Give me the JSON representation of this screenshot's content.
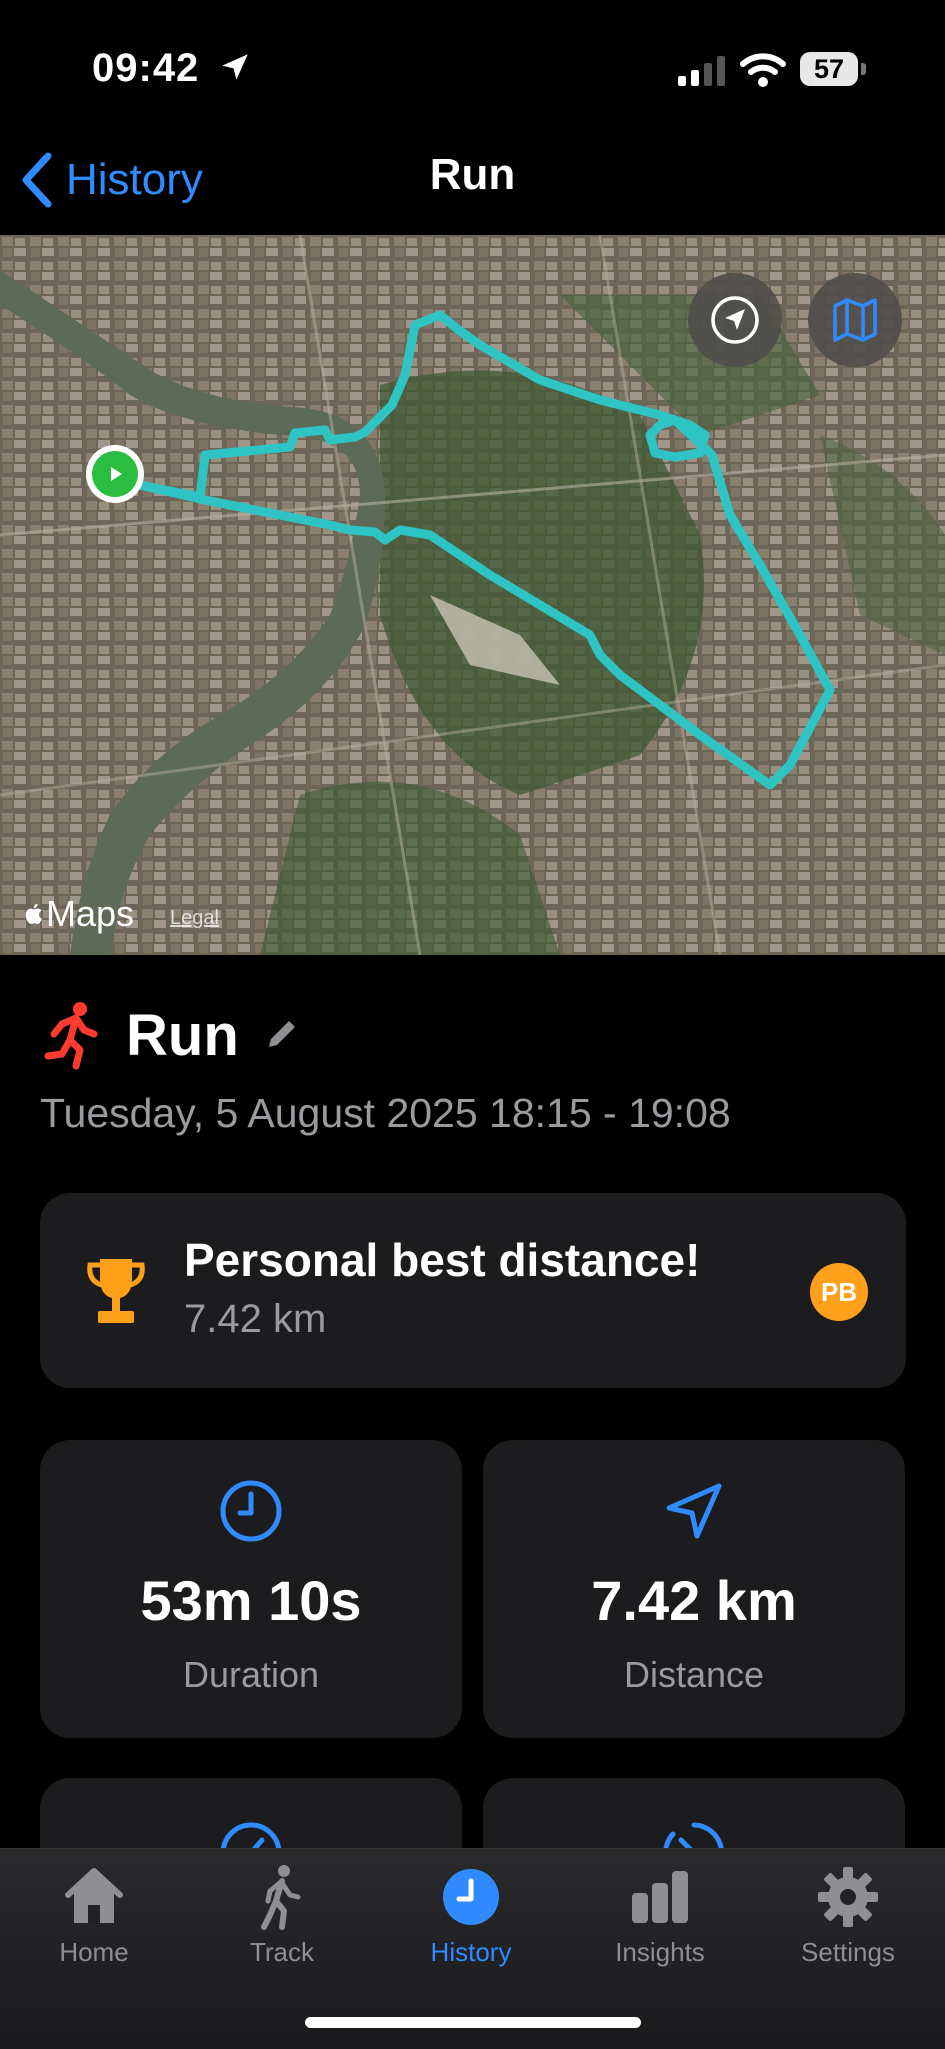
{
  "status_bar": {
    "time": "09:42",
    "battery": "57"
  },
  "nav": {
    "back_label": "History",
    "title": "Run"
  },
  "map": {
    "attribution": "Maps",
    "legal": "Legal",
    "route_color": "#2ec4c4"
  },
  "activity": {
    "title": "Run",
    "datetime": "Tuesday, 5 August 2025 18:15 - 19:08"
  },
  "personal_best": {
    "title": "Personal best distance!",
    "value": "7.42 km",
    "badge": "PB"
  },
  "stats": [
    {
      "value": "53m 10s",
      "label": "Duration",
      "icon": "clock-icon"
    },
    {
      "value": "7.42 km",
      "label": "Distance",
      "icon": "location-arrow-icon"
    }
  ],
  "tabs": [
    {
      "label": "Home",
      "icon": "house-icon"
    },
    {
      "label": "Track",
      "icon": "walker-icon"
    },
    {
      "label": "History",
      "icon": "clock-icon",
      "active": true
    },
    {
      "label": "Insights",
      "icon": "bar-chart-icon"
    },
    {
      "label": "Settings",
      "icon": "gear-icon"
    }
  ],
  "colors": {
    "accent": "#2f8bff",
    "pb": "#ffa01a",
    "run_icon": "#ff3b30"
  }
}
